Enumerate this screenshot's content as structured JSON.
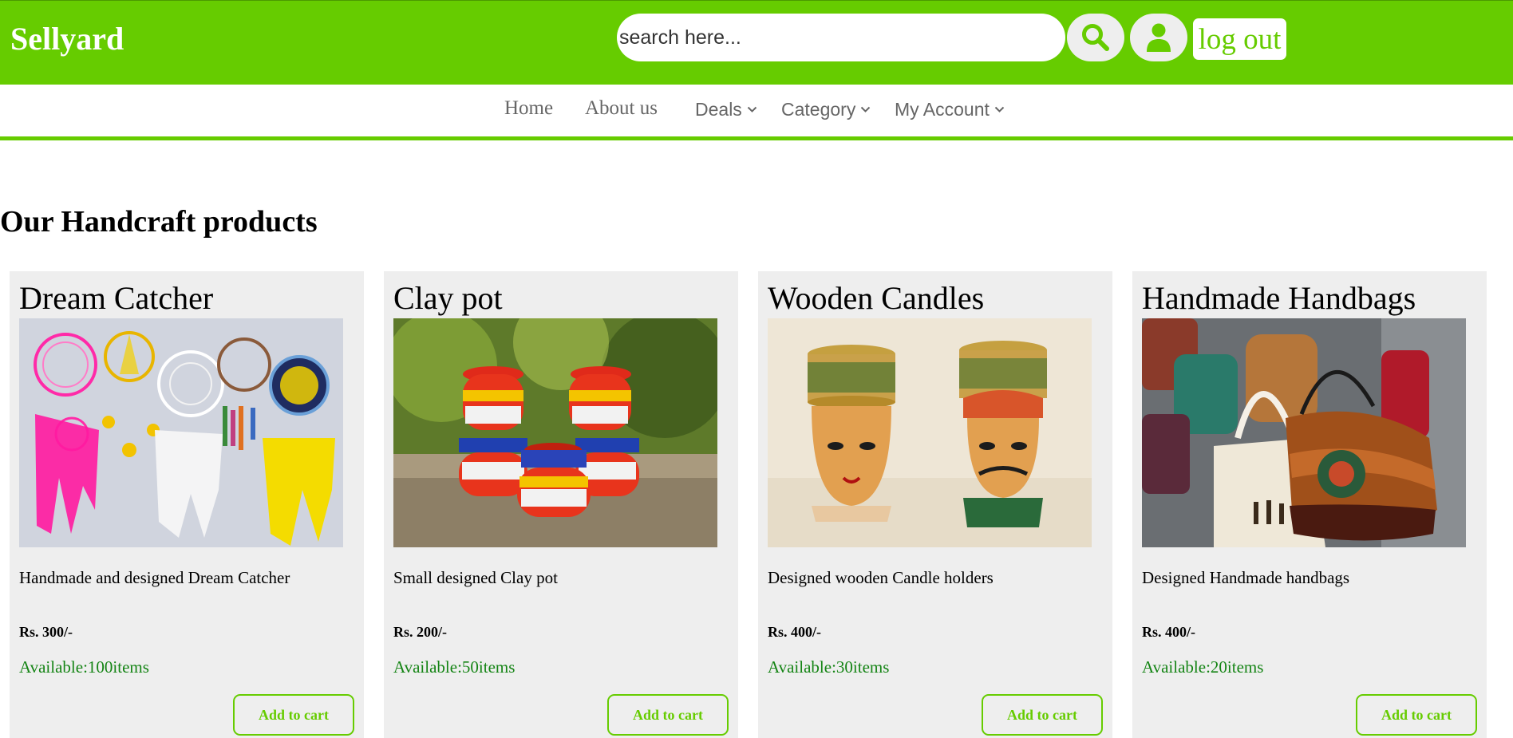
{
  "header": {
    "brand": "Sellyard",
    "search_placeholder": "search here...",
    "search_icon": "search-icon",
    "user_icon": "user-icon",
    "logout_label": "log out",
    "accent_color": "#66cc00"
  },
  "nav": {
    "items": [
      {
        "label": "Home",
        "dropdown": false
      },
      {
        "label": "About us",
        "dropdown": false
      },
      {
        "label": "Deals",
        "dropdown": true
      },
      {
        "label": "Category",
        "dropdown": true
      },
      {
        "label": "My Account",
        "dropdown": true
      }
    ]
  },
  "main": {
    "heading": "Our Handcraft products",
    "products": [
      {
        "title": "Dream Catcher",
        "image": "dream-catchers-photo",
        "description": "Handmade and designed Dream Catcher",
        "price": "Rs. 300/-",
        "availability": "Available:100items",
        "button_label": "Add to cart"
      },
      {
        "title": "Clay pot",
        "image": "painted-clay-pots-photo",
        "description": "Small designed Clay pot",
        "price": "Rs. 200/-",
        "availability": "Available:50items",
        "button_label": "Add to cart"
      },
      {
        "title": "Wooden Candles",
        "image": "wooden-candle-holders-photo",
        "description": "Designed wooden Candle holders",
        "price": "Rs. 400/-",
        "availability": "Available:30items",
        "button_label": "Add to cart"
      },
      {
        "title": "Handmade Handbags",
        "image": "woven-handbags-photo",
        "description": "Designed Handmade handbags",
        "price": "Rs. 400/-",
        "availability": "Available:20items",
        "button_label": "Add to cart"
      }
    ]
  }
}
